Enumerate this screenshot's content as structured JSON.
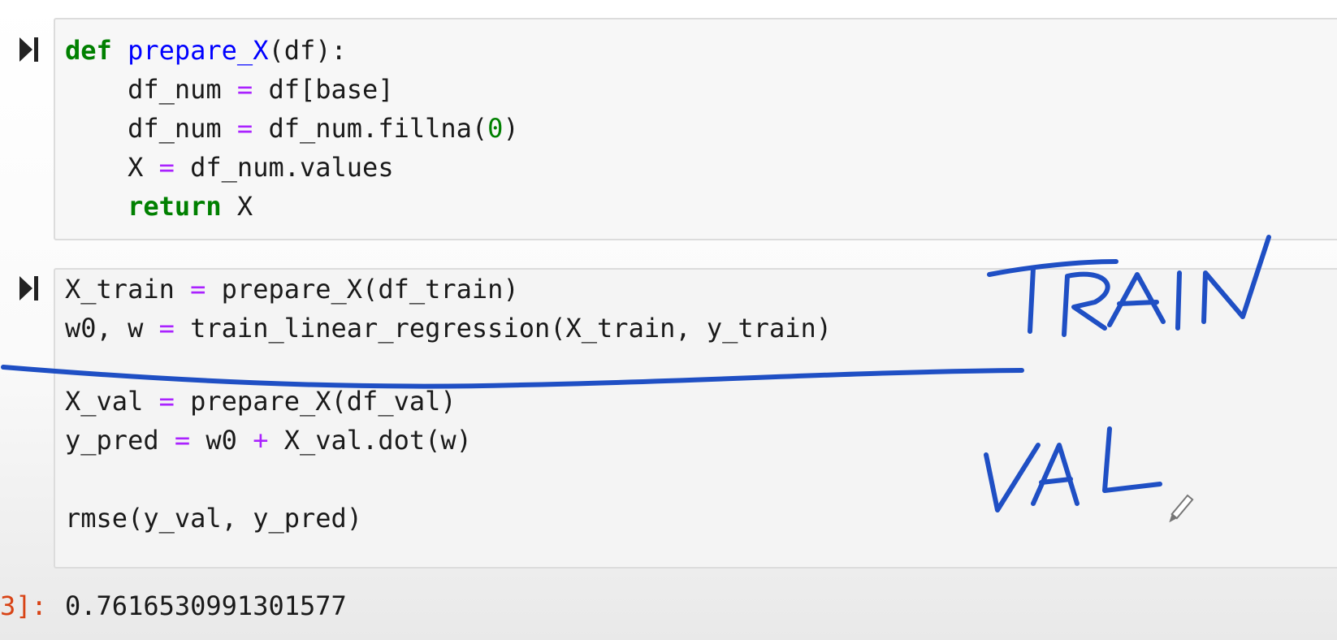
{
  "cell1": {
    "line1": {
      "kw": "def",
      "fn": "prepare_X",
      "rest": "(df):"
    },
    "line2": {
      "indent": "    ",
      "a": "df_num",
      "op": "=",
      "b": "df[base]"
    },
    "line3": {
      "indent": "    ",
      "a": "df_num",
      "op": "=",
      "b": "df_num.fillna(",
      "num": "0",
      "c": ")"
    },
    "line4": {
      "indent": "    ",
      "a": "X",
      "op": "=",
      "b": "df_num.values"
    },
    "line5": {
      "indent": "    ",
      "kw": "return",
      "rest": " X"
    }
  },
  "cell2": {
    "line1": {
      "a": "X_train",
      "op": "=",
      "b": "prepare_X(df_train)"
    },
    "line2": {
      "a": "w0, w",
      "op": "=",
      "b": "train_linear_regression(X_train, y_train)"
    },
    "line3": {
      "a": "X_val",
      "op": "=",
      "b": "prepare_X(df_val)"
    },
    "line4": {
      "a": "y_pred",
      "op": "=",
      "b": "w0",
      "op2": "+",
      "c": "X_val.dot(w)"
    },
    "line6": {
      "a": "rmse(y_val, y_pred)"
    }
  },
  "output": {
    "prompt": "3]:",
    "value": "0.7616530991301577"
  },
  "annotations": {
    "train_label": "TRAIN",
    "val_label": "VAL",
    "ink_color": "#1f4fc4"
  },
  "icons": {
    "run": "run-step-icon",
    "pen": "pen-cursor-icon"
  }
}
